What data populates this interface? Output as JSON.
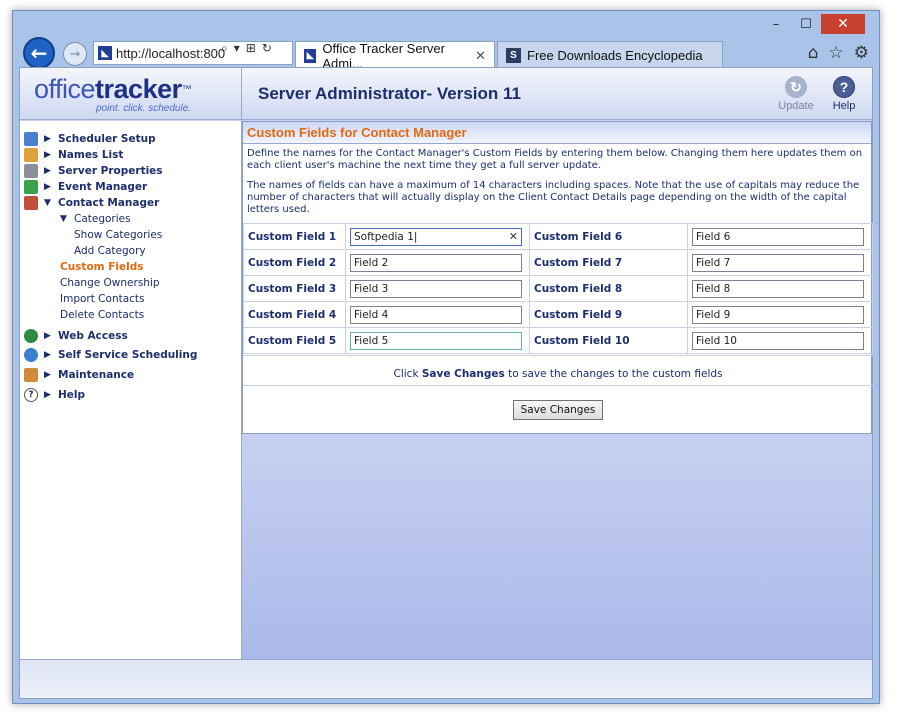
{
  "browser": {
    "address": "http://localhost:800",
    "tabs": [
      {
        "label": "Office Tracker Server Admi...",
        "active": true
      },
      {
        "label": "Free Downloads Encyclopedia",
        "active": false
      }
    ],
    "window_buttons": {
      "minimize": "–",
      "maximize": "☐",
      "close": "✕"
    }
  },
  "header": {
    "logo_thin": "office",
    "logo_bold": "tracker",
    "logo_tm": "™",
    "logo_tagline": "point. click. schedule.",
    "title": "Server Administrator- Version 11",
    "update_label": "Update",
    "help_label": "Help"
  },
  "sidebar": {
    "items": [
      {
        "label": "Scheduler Setup",
        "icon": "calendar-grid-icon"
      },
      {
        "label": "Names List",
        "icon": "people-icon"
      },
      {
        "label": "Server Properties",
        "icon": "server-icon"
      },
      {
        "label": "Event Manager",
        "icon": "event-icon"
      },
      {
        "label": "Contact Manager",
        "icon": "contact-book-icon"
      }
    ],
    "contact_sub": {
      "categories": "Categories",
      "show_categories": "Show Categories",
      "add_category": "Add Category",
      "custom_fields": "Custom Fields",
      "change_ownership": "Change Ownership",
      "import_contacts": "Import Contacts",
      "delete_contacts": "Delete Contacts"
    },
    "bottom_items": [
      {
        "label": "Web Access",
        "icon": "globe-icon"
      },
      {
        "label": "Self Service Scheduling",
        "icon": "globe-people-icon"
      },
      {
        "label": "Maintenance",
        "icon": "wrench-icon"
      },
      {
        "label": "Help",
        "icon": "question-icon"
      }
    ]
  },
  "panel": {
    "title": "Custom Fields for Contact Manager",
    "desc1": "Define the names for the Contact Manager's Custom Fields by entering them below. Changing them here updates them on each client user's machine the next time they get a full server update.",
    "desc2": "The names of fields can have a maximum of 14 characters including spaces. Note that the use of capitals may reduce the number of characters that will actually display on the Client Contact Details page depending on the width of the capital letters used.",
    "fields": [
      {
        "label": "Custom Field 1",
        "value": "Softpedia 1",
        "label2": "Custom Field 6",
        "value2": "Field 6"
      },
      {
        "label": "Custom Field 2",
        "value": "Field 2",
        "label2": "Custom Field 7",
        "value2": "Field 7"
      },
      {
        "label": "Custom Field 3",
        "value": "Field 3",
        "label2": "Custom Field 8",
        "value2": "Field 8"
      },
      {
        "label": "Custom Field 4",
        "value": "Field 4",
        "label2": "Custom Field 9",
        "value2": "Field 9"
      },
      {
        "label": "Custom Field 5",
        "value": "Field 5",
        "label2": "Custom Field 10",
        "value2": "Field 10"
      }
    ],
    "hint_pre": "Click ",
    "hint_bold": "Save Changes",
    "hint_post": " to save the changes to the custom fields",
    "save_label": "Save Changes"
  }
}
